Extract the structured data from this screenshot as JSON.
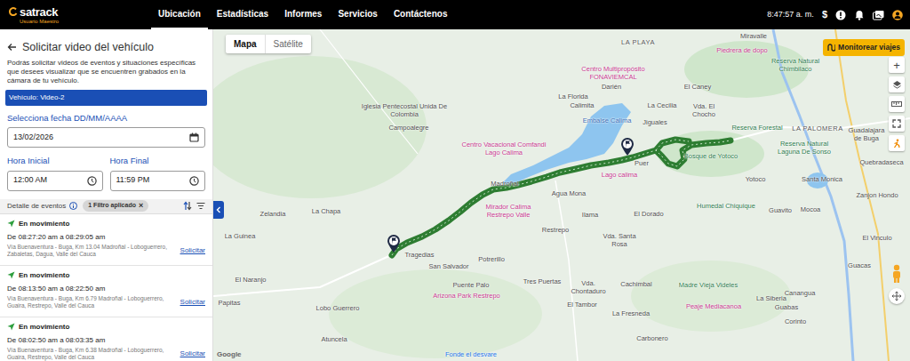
{
  "nav": {
    "logo": "satrack",
    "logo_subtitle": "Usuario Maestro",
    "items": [
      {
        "label": "Ubicación",
        "selected": true
      },
      {
        "label": "Estadísticas",
        "selected": false
      },
      {
        "label": "Informes",
        "selected": false
      },
      {
        "label": "Servicios",
        "selected": false
      },
      {
        "label": "Contáctenos",
        "selected": false
      }
    ],
    "clock": "8:47:57 a. m.",
    "currency": "$"
  },
  "panel": {
    "title": "Solicitar video del vehículo",
    "description": "Podrás solicitar videos de eventos y situaciones específicas que desees visualizar que se encuentren grabados en la cámara de tu vehículo.",
    "vehicle": "Vehículo: Video-2",
    "date_label": "Selecciona fecha DD/MM/AAAA",
    "date_value": "13/02/2026",
    "start_label": "Hora Inicial",
    "start_value": "12:00 AM",
    "end_label": "Hora Final",
    "end_value": "11:59 PM",
    "events_title": "Detalle de eventos",
    "filter_chip": "1 Filtro aplicado",
    "filter_clear": "×",
    "events": [
      {
        "status": "En movimiento",
        "time": "De 08:27:20 am a 08:29:05 am",
        "address": "Vía Buenaventura - Buga, Km 13.04 Madroñal - Loboguerrero, Zabaletas, Dagua, Valle del Cauca",
        "action": "Solicitar"
      },
      {
        "status": "En movimiento",
        "time": "De 08:13:50 am a 08:22:50 am",
        "address": "Vía Buenaventura - Buga, Km 6.79 Madroñal - Loboguerrero, Guaira, Restrepo, Valle del Cauca",
        "action": "Solicitar"
      },
      {
        "status": "En movimiento",
        "time": "De 08:02:50 am a 08:03:35 am",
        "address": "Vía Buenaventura - Buga, Km 6.38 Madroñal - Loboguerrero, Guaira, Restrepo, Valle del Cauca",
        "action": "Solicitar"
      }
    ]
  },
  "map": {
    "tabs": [
      {
        "label": "Mapa",
        "selected": true
      },
      {
        "label": "Satélite",
        "selected": false
      }
    ],
    "monitor_button": "Monitorear viajes",
    "zoom_in": "+",
    "attribution": "Google",
    "labels": [
      {
        "text": "Miravalle",
        "kind": "town"
      },
      {
        "text": "LA PLAYA",
        "kind": "caps"
      },
      {
        "text": "Piedrera de dopo",
        "kind": "poi"
      },
      {
        "text": "Centro Multipropósito FONAVIEMCAL",
        "kind": "poi"
      },
      {
        "text": "Reserva Natural Chimbilaco",
        "kind": "park"
      },
      {
        "text": "Darién",
        "kind": "town"
      },
      {
        "text": "El Caney",
        "kind": "town"
      },
      {
        "text": "La Florida",
        "kind": "town"
      },
      {
        "text": "Iglesia Pentecostal Unida De Colombia",
        "kind": "town"
      },
      {
        "text": "Calimita",
        "kind": "town"
      },
      {
        "text": "La Cecilia",
        "kind": "town"
      },
      {
        "text": "Vda. El Chocho",
        "kind": "town"
      },
      {
        "text": "Embalse Calima",
        "kind": "water"
      },
      {
        "text": "Jiguales",
        "kind": "town"
      },
      {
        "text": "Campoalegre",
        "kind": "town"
      },
      {
        "text": "Reserva Forestal",
        "kind": "park"
      },
      {
        "text": "LA PALOMERA",
        "kind": "caps"
      },
      {
        "text": "Guadalajara de Buga",
        "kind": "town"
      },
      {
        "text": "Centro Vacacional Comfandi Lago Calima",
        "kind": "poi"
      },
      {
        "text": "Reserva Natural Laguna De Sonso",
        "kind": "park"
      },
      {
        "text": "Bosque de Yotoco",
        "kind": "park"
      },
      {
        "text": "Puer",
        "kind": "town"
      },
      {
        "text": "Quebradaseca",
        "kind": "town"
      },
      {
        "text": "Lago calima",
        "kind": "poi"
      },
      {
        "text": "Yotoco",
        "kind": "town"
      },
      {
        "text": "Santa Monica",
        "kind": "town"
      },
      {
        "text": "Madroñal",
        "kind": "town"
      },
      {
        "text": "Agua Mona",
        "kind": "town"
      },
      {
        "text": "Zanjon Hondo",
        "kind": "town"
      },
      {
        "text": "Humedal Chiquique",
        "kind": "park"
      },
      {
        "text": "Mirador Calima Restrepo Valle",
        "kind": "poi"
      },
      {
        "text": "La Chapa",
        "kind": "town"
      },
      {
        "text": "Zelandia",
        "kind": "town"
      },
      {
        "text": "El Dorado",
        "kind": "town"
      },
      {
        "text": "Ilama",
        "kind": "town"
      },
      {
        "text": "Guavito",
        "kind": "town"
      },
      {
        "text": "Mocoa",
        "kind": "town"
      },
      {
        "text": "Restrepo",
        "kind": "town"
      },
      {
        "text": "La Guinea",
        "kind": "town"
      },
      {
        "text": "Vda. Santa Rosa",
        "kind": "town"
      },
      {
        "text": "El Vinculo",
        "kind": "town"
      },
      {
        "text": "Tragedias",
        "kind": "town"
      },
      {
        "text": "Potrerillo",
        "kind": "town"
      },
      {
        "text": "Guacas",
        "kind": "town"
      },
      {
        "text": "San Salvador",
        "kind": "town"
      },
      {
        "text": "El Naranjo",
        "kind": "town"
      },
      {
        "text": "Tres Puertas",
        "kind": "town"
      },
      {
        "text": "Cachimbal",
        "kind": "town"
      },
      {
        "text": "Madre Vieja Videles",
        "kind": "park"
      },
      {
        "text": "Puente Palo",
        "kind": "town"
      },
      {
        "text": "Vda. Chontaduro",
        "kind": "town"
      },
      {
        "text": "Canangua",
        "kind": "town"
      },
      {
        "text": "Arizona Park Restrepo",
        "kind": "poi"
      },
      {
        "text": "La Siberia",
        "kind": "town"
      },
      {
        "text": "Papitas",
        "kind": "town"
      },
      {
        "text": "El Tambor",
        "kind": "town"
      },
      {
        "text": "Guabas",
        "kind": "town"
      },
      {
        "text": "Peaje Mediacanoa",
        "kind": "poi"
      },
      {
        "text": "Lobo Guerrero",
        "kind": "town"
      },
      {
        "text": "La Fresneda",
        "kind": "town"
      },
      {
        "text": "Corinto",
        "kind": "town"
      },
      {
        "text": "Carbonero",
        "kind": "town"
      },
      {
        "text": "Atuncela",
        "kind": "town"
      },
      {
        "text": "Fonde el desvare",
        "kind": "shop"
      }
    ]
  }
}
